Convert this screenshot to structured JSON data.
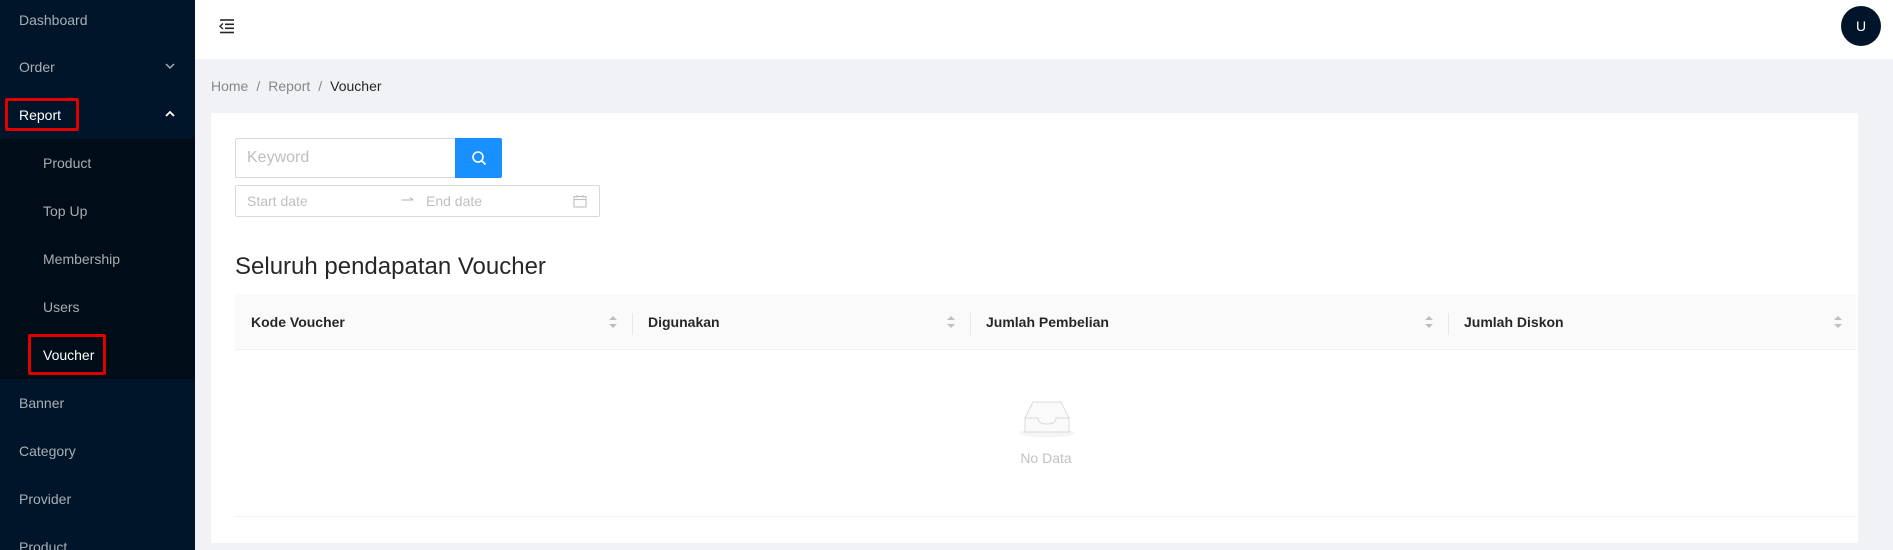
{
  "sidebar": {
    "items": [
      {
        "label": "Dashboard"
      },
      {
        "label": "Order"
      },
      {
        "label": "Report"
      },
      {
        "label": "Product"
      },
      {
        "label": "Top Up"
      },
      {
        "label": "Membership"
      },
      {
        "label": "Users"
      },
      {
        "label": "Voucher"
      },
      {
        "label": "Banner"
      },
      {
        "label": "Category"
      },
      {
        "label": "Provider"
      },
      {
        "label": "Product"
      }
    ]
  },
  "header": {
    "avatar_initial": "U"
  },
  "breadcrumb": {
    "items": [
      "Home",
      "Report",
      "Voucher"
    ],
    "separator": "/"
  },
  "search": {
    "placeholder": "Keyword"
  },
  "date_range": {
    "start_placeholder": "Start date",
    "end_placeholder": "End date"
  },
  "section": {
    "title": "Seluruh pendapatan Voucher"
  },
  "table": {
    "columns": [
      "Kode Voucher",
      "Digunakan",
      "Jumlah Pembelian",
      "Jumlah Diskon"
    ],
    "rows": [],
    "empty_text": "No Data"
  },
  "colors": {
    "sidebar_bg": "#001529",
    "submenu_bg": "#000c17",
    "primary": "#1890ff",
    "highlight": "#e00000"
  }
}
